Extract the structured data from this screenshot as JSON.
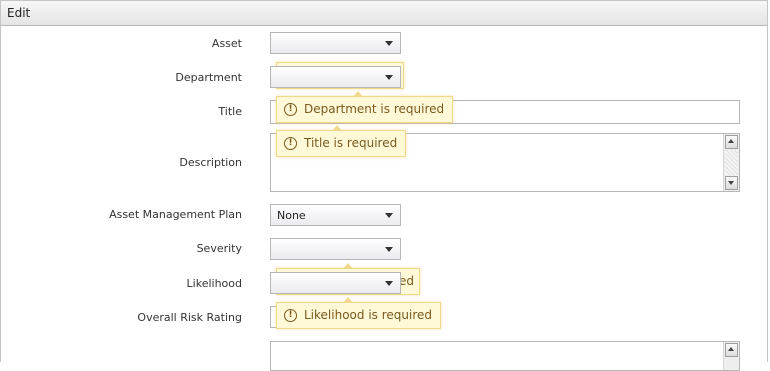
{
  "window": {
    "title": "Edit"
  },
  "form": {
    "asset": {
      "label": "Asset",
      "value": ""
    },
    "department": {
      "label": "Department",
      "value": ""
    },
    "title": {
      "label": "Title",
      "value": ""
    },
    "description": {
      "label": "Description",
      "value": ""
    },
    "asset_management_plan": {
      "label": "Asset Management Plan",
      "value": "None"
    },
    "severity": {
      "label": "Severity",
      "value": ""
    },
    "likelihood": {
      "label": "Likelihood",
      "value": ""
    },
    "overall_risk_rating": {
      "label": "Overall Risk Rating",
      "value": ""
    }
  },
  "validation": {
    "department": "Department is required",
    "title": "Title is required",
    "severity_partial": "ed",
    "likelihood": "Likelihood is required"
  },
  "icons": {
    "warning": "exclamation-circle-icon",
    "dropdown": "chevron-down-icon"
  }
}
